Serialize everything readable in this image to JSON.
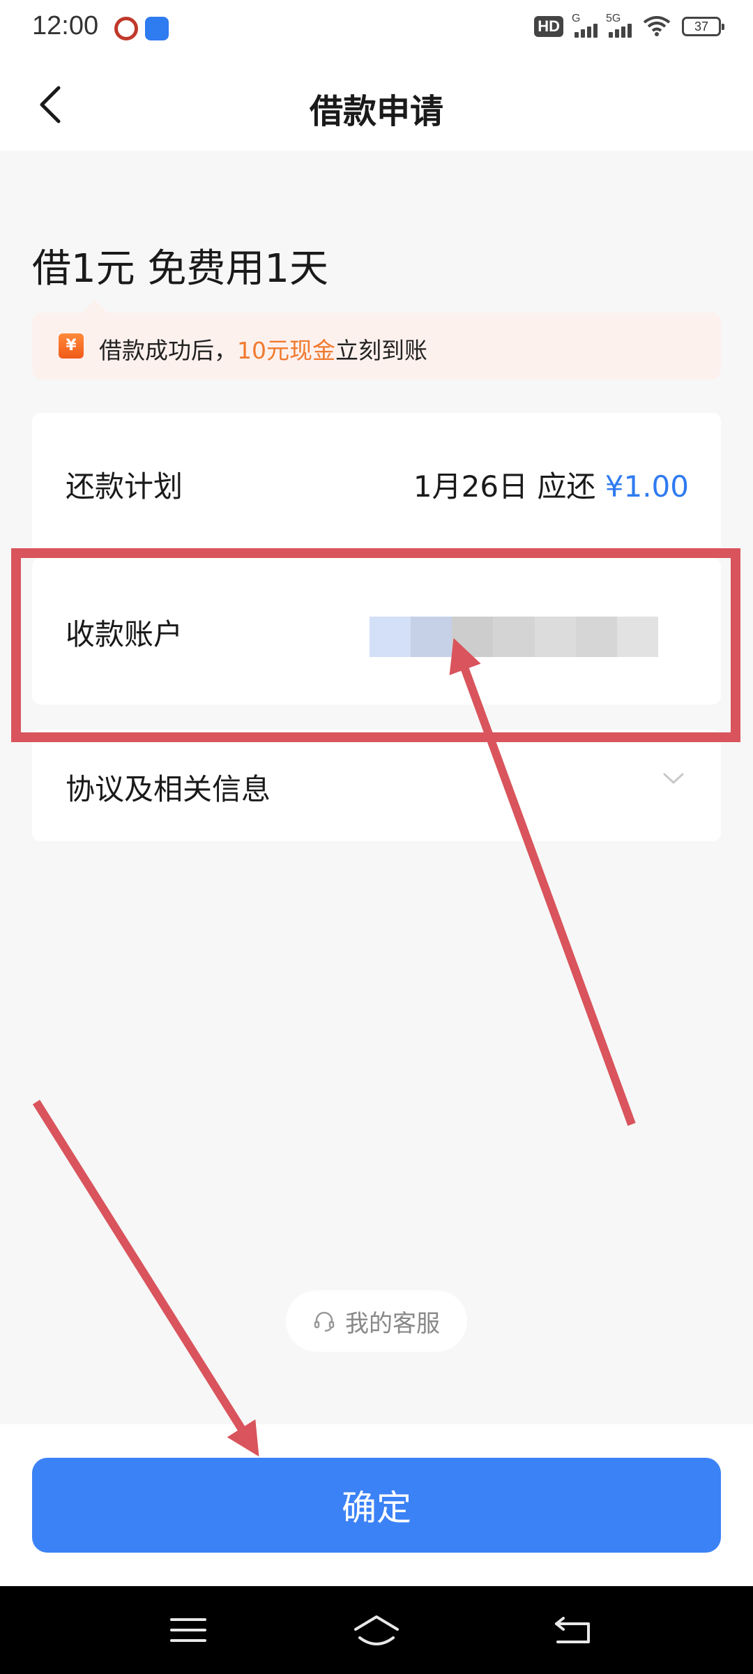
{
  "status_bar": {
    "time": "12:00",
    "hd_badge": "HD",
    "signal_1_tag": "G",
    "signal_2_tag": "5G",
    "battery": "37"
  },
  "header": {
    "title": "借款申请"
  },
  "loan": {
    "heading": "借1元 免费用1天",
    "promo_prefix": "借款成功后，",
    "promo_highlight": "10元现金",
    "promo_suffix": "立刻到账",
    "promo_icon_glyph": "¥"
  },
  "repay_plan": {
    "label": "还款计划",
    "date_text": "1月26日 应还 ",
    "amount": "¥1.00"
  },
  "receiving_account": {
    "label": "收款账户"
  },
  "agreement": {
    "label": "协议及相关信息"
  },
  "service": {
    "label": "我的客服"
  },
  "confirm": {
    "label": "确定"
  },
  "colors": {
    "accent_blue": "#3b82f6",
    "promo_orange": "#f07a2e",
    "annotation_red": "#d9545c"
  }
}
